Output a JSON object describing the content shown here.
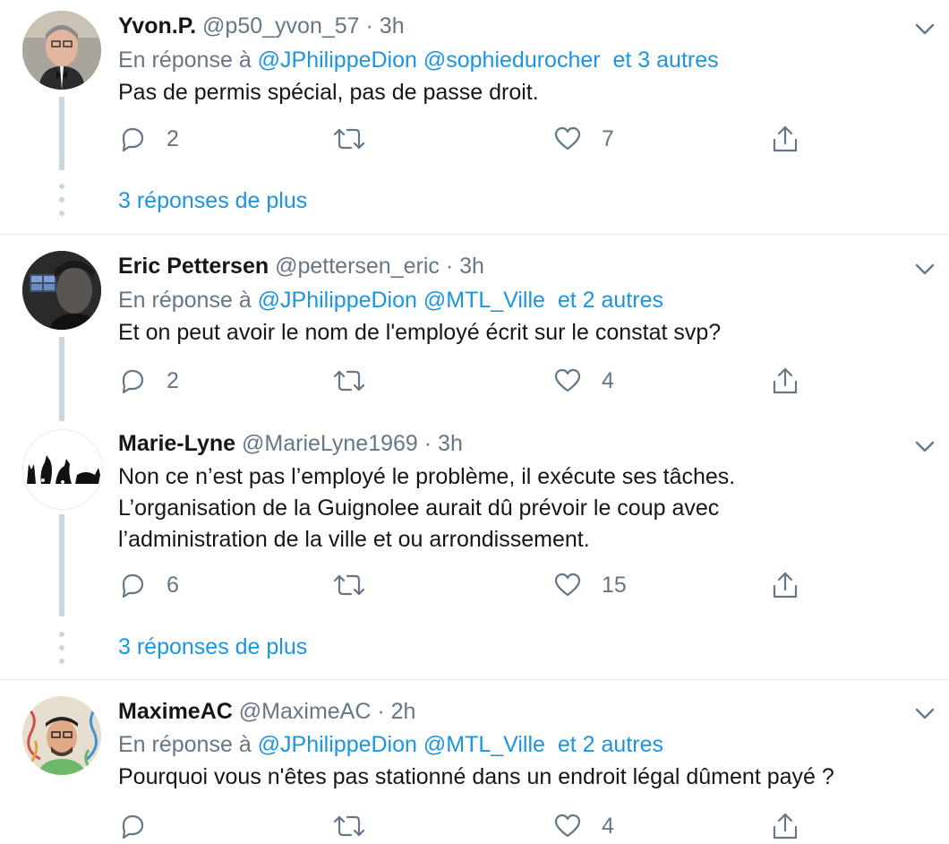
{
  "tweets": [
    {
      "name": "Yvon.P.",
      "handle": "@p50_yvon_57",
      "sep": "·",
      "time": "3h",
      "reply_prefix": "En réponse à",
      "mentions": "@JPhilippeDion @sophiedurocher",
      "others": "et 3 autres",
      "text": "Pas de permis spécial, pas de passe droit.",
      "replies": "2",
      "retweets": "",
      "likes": "7",
      "more_replies": "3 réponses de plus"
    },
    {
      "name": "Eric Pettersen",
      "handle": "@pettersen_eric",
      "sep": "·",
      "time": "3h",
      "reply_prefix": "En réponse à",
      "mentions": "@JPhilippeDion @MTL_Ville",
      "others": "et 2 autres",
      "text": "Et on peut avoir le nom de l'employé écrit sur le constat svp?",
      "replies": "2",
      "retweets": "",
      "likes": "4"
    },
    {
      "name": "Marie-Lyne",
      "handle": "@MarieLyne1969",
      "sep": "·",
      "time": "3h",
      "text_lines": [
        "Non ce n’est pas l’employé le problème, il exécute ses tâches.",
        "L’organisation de la Guignolee aurait dû prévoir le coup avec",
        "l’administration de la ville et ou arrondissement."
      ],
      "replies": "6",
      "retweets": "",
      "likes": "15",
      "more_replies": "3 réponses de plus"
    },
    {
      "name": "MaximeAC",
      "handle": "@MaximeAC",
      "sep": "·",
      "time": "2h",
      "reply_prefix": "En réponse à",
      "mentions": "@JPhilippeDion @MTL_Ville",
      "others": "et 2 autres",
      "text": "Pourquoi vous n'êtes pas stationné dans un endroit légal dûment payé ?",
      "replies": "",
      "retweets": "",
      "likes": "4"
    }
  ],
  "icons": {
    "reply": "reply-icon",
    "retweet": "retweet-icon",
    "like": "heart-icon",
    "share": "share-icon",
    "menu": "chevron-down-icon"
  },
  "colors": {
    "link": "#1b95e0",
    "muted": "#657786",
    "line": "#ccd6dd"
  }
}
